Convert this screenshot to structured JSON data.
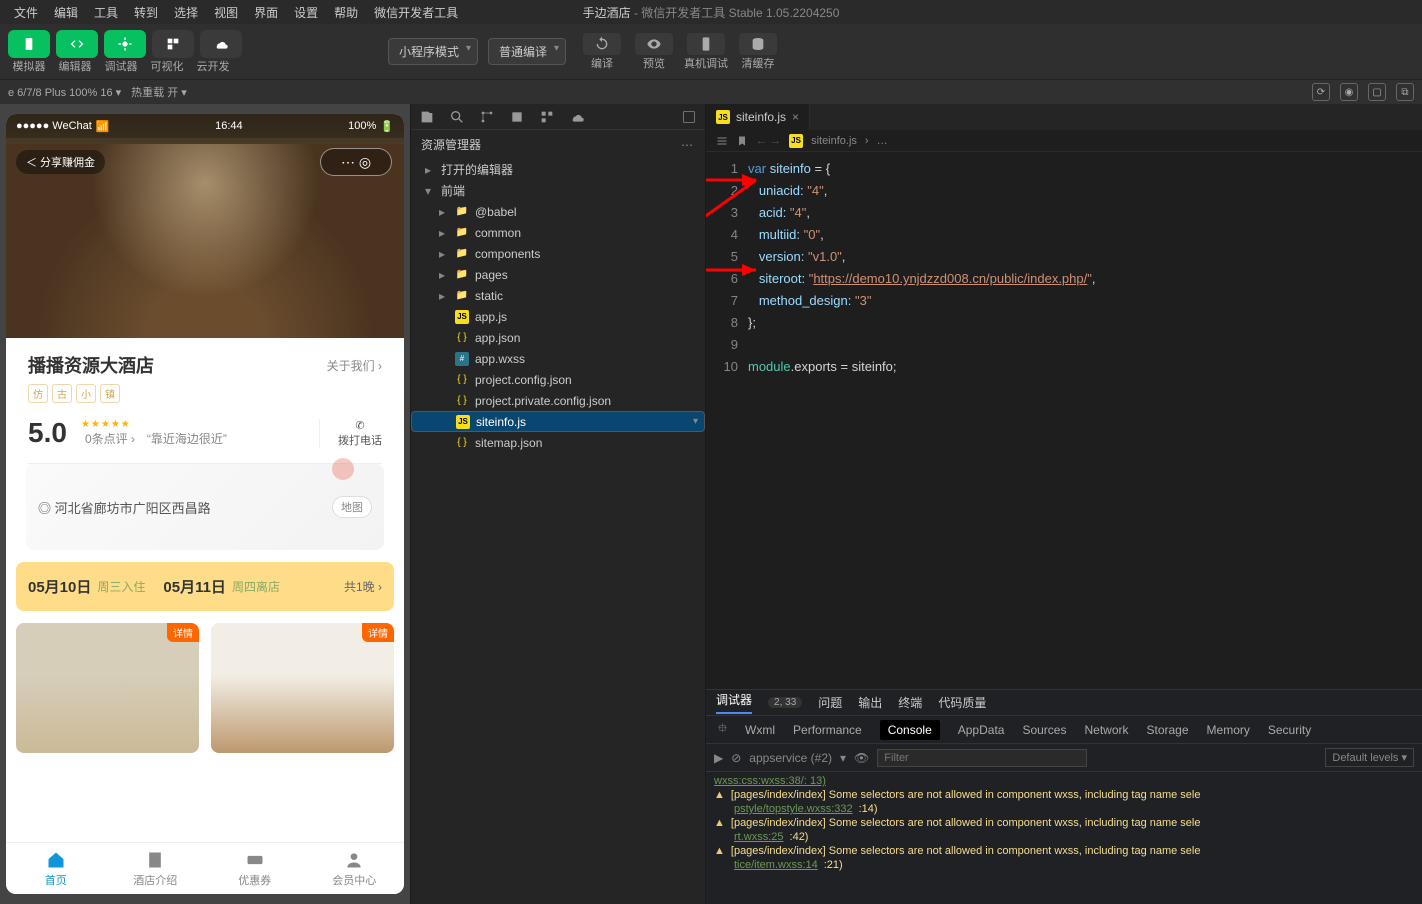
{
  "menubar": {
    "items": [
      "文件",
      "编辑",
      "工具",
      "转到",
      "选择",
      "视图",
      "界面",
      "设置",
      "帮助",
      "微信开发者工具"
    ],
    "title_project": "手边酒店",
    "title_suffix": " - 微信开发者工具 Stable 1.05.2204250"
  },
  "toolbar": {
    "view_labels": [
      "模拟器",
      "编辑器",
      "调试器"
    ],
    "extra_labels": [
      "可视化",
      "云开发"
    ],
    "mode_select": "小程序模式",
    "compile_select": "普通编译",
    "right_buttons": [
      "编译",
      "预览",
      "真机调试",
      "清缓存"
    ]
  },
  "devbar": {
    "device": "e 6/7/8 Plus 100% 16 ▾",
    "reload": "热重载 开 ▾"
  },
  "phone": {
    "status": {
      "carrier": "●●●●● WeChat",
      "wifi": "wifi",
      "time": "16:44",
      "battery": "100%"
    },
    "hero_chip": "＜ 分享赚佣金",
    "caps": "⋯  ◎",
    "hotel": "播播资源大酒店",
    "about": "关于我们 ›",
    "tags": [
      "仿",
      "古",
      "小",
      "镇"
    ],
    "score": "5.0",
    "reviews": "0条点评 ›",
    "quote": "“靠近海边很近”",
    "call": "拨打电话",
    "addr": "◎ 河北省廊坊市广阳区西昌路",
    "map": "地图",
    "date": {
      "d1": "05月10日",
      "l1": "周三入住",
      "d2": "05月11日",
      "l2": "周四离店",
      "n": "共1晚 ›"
    },
    "room_badge": "详情",
    "tabs": [
      "首页",
      "酒店介绍",
      "优惠券",
      "会员中心"
    ]
  },
  "explorer": {
    "title": "资源管理器",
    "sec_editors": "打开的编辑器",
    "root": "前端",
    "folders": [
      "@babel",
      "common",
      "components",
      "pages",
      "static"
    ],
    "files": [
      "app.js",
      "app.json",
      "app.wxss",
      "project.config.json",
      "project.private.config.json",
      "siteinfo.js",
      "sitemap.json"
    ],
    "file_icons": [
      "js",
      "json",
      "wxss",
      "json",
      "json",
      "js",
      "json"
    ]
  },
  "editor": {
    "tab": "siteinfo.js",
    "breadcrumb": [
      "siteinfo.js",
      "…"
    ],
    "code": {
      "l1": {
        "kw": "var",
        "id": "siteinfo",
        "op": " = {"
      },
      "l2": {
        "k": "uniacid:",
        "v": " \"4\"",
        "c": ","
      },
      "l3": {
        "k": "acid:",
        "v": " \"4\"",
        "c": ","
      },
      "l4": {
        "k": "multiid:",
        "v": " \"0\"",
        "c": ","
      },
      "l5": {
        "k": "version:",
        "v": " \"v1.0\"",
        "c": ","
      },
      "l6": {
        "k": "siteroot:",
        "v": " \"",
        "url": "https://demo10.ynjdzzd008.cn/public/index.php/",
        "v2": "\"",
        "c": ","
      },
      "l7": {
        "k": "method_design:",
        "v": " \"3\""
      },
      "l8": "};",
      "l10": {
        "a": "module",
        "b": ".exports = siteinfo;"
      }
    }
  },
  "devtools": {
    "top_tabs": {
      "debugger": "调试器",
      "count": "2, 33",
      "problems": "问题",
      "output": "输出",
      "terminal": "终端",
      "quality": "代码质量"
    },
    "tabs": [
      "Wxml",
      "Performance",
      "Console",
      "AppData",
      "Sources",
      "Network",
      "Storage",
      "Memory",
      "Security"
    ],
    "filter_src": "appservice (#2)",
    "filter_placeholder": "Filter",
    "levels": "Default levels ▾",
    "logs": [
      {
        "pre": "wxss:css:wxss:38/: 13)",
        "link": ""
      },
      {
        "msg": "[pages/index/index] Some selectors are not allowed in component wxss, including tag name sele",
        "link": "pstyle/topstyle.wxss:332",
        "ln": ":14)"
      },
      {
        "msg": "[pages/index/index] Some selectors are not allowed in component wxss, including tag name sele",
        "link": "rt.wxss:25",
        "ln": ":42)"
      },
      {
        "msg": "[pages/index/index] Some selectors are not allowed in component wxss, including tag name sele",
        "link": "tice/item.wxss:14",
        "ln": ":21)"
      }
    ]
  }
}
